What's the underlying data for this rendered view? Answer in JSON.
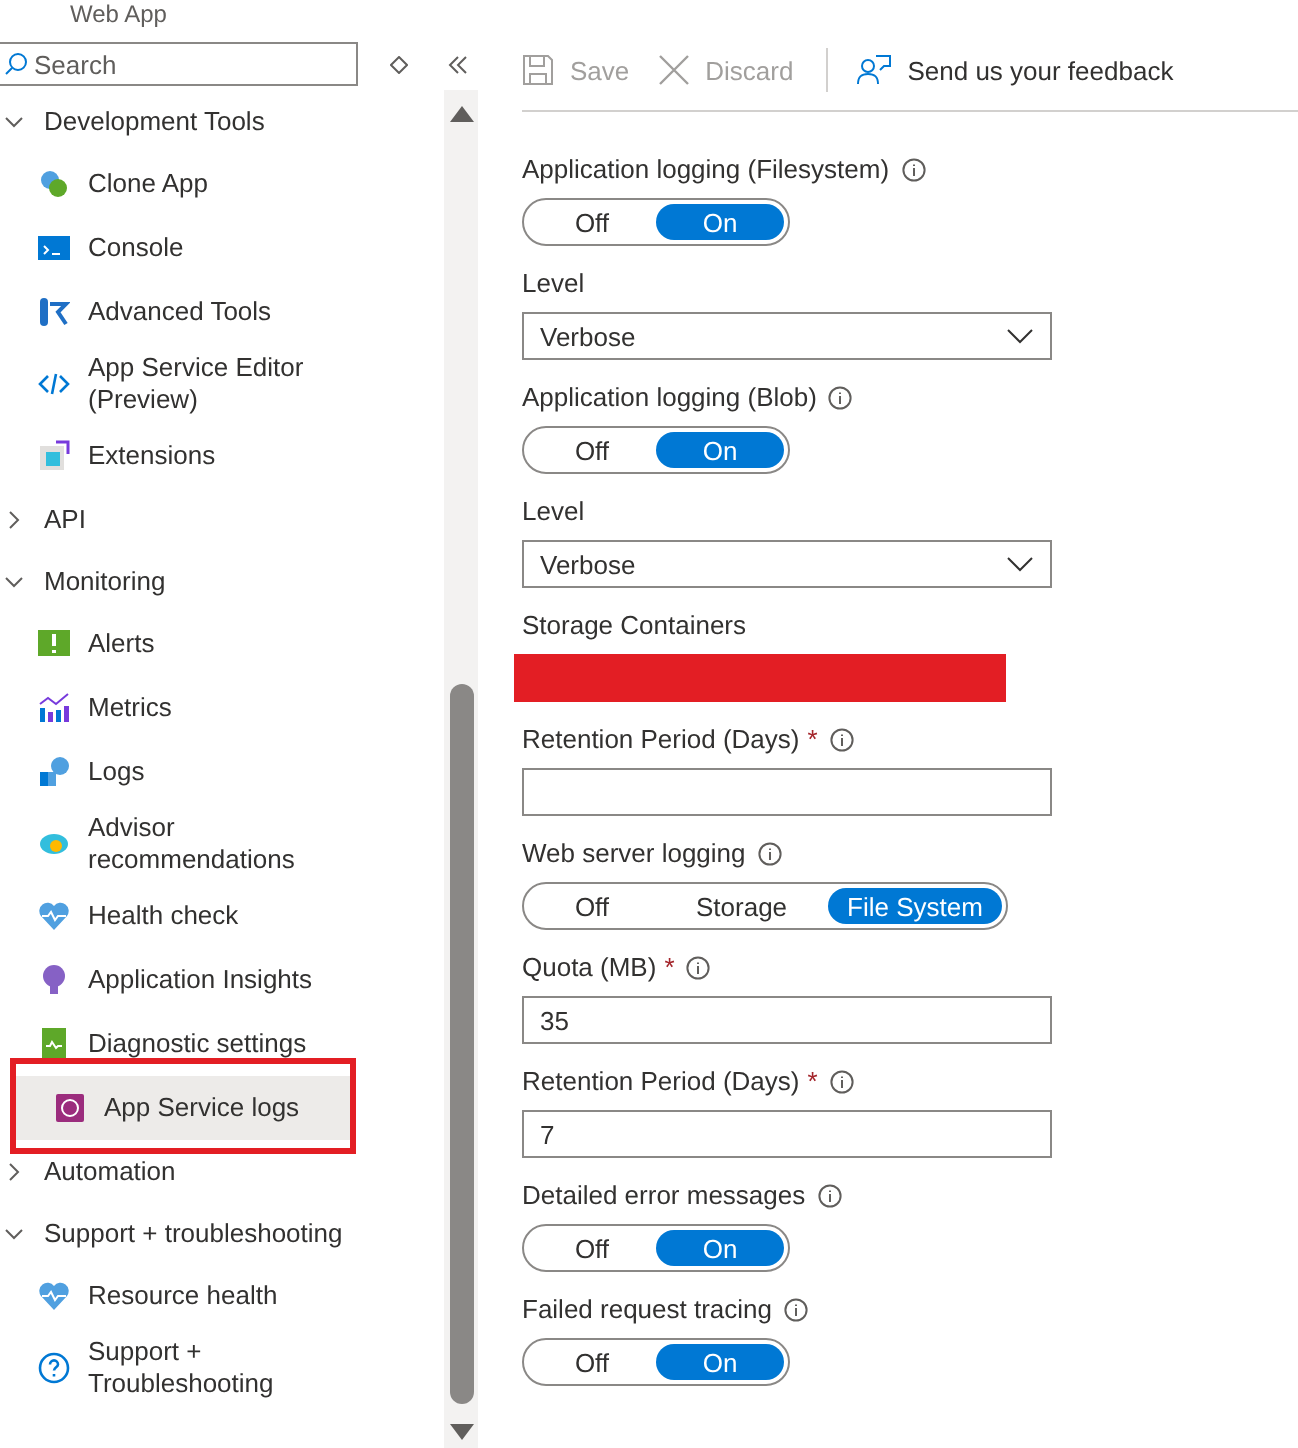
{
  "header": {
    "title": "Web App"
  },
  "search": {
    "placeholder": "Search"
  },
  "sidebar": {
    "groups": [
      {
        "label": "Development Tools",
        "expanded": true,
        "children": [
          {
            "label": "Clone App",
            "selected": false
          },
          {
            "label": "Console",
            "selected": false
          },
          {
            "label": "Advanced Tools",
            "selected": false
          },
          {
            "label": "App Service Editor (Preview)",
            "selected": false
          },
          {
            "label": "Extensions",
            "selected": false
          }
        ]
      },
      {
        "label": "API",
        "expanded": false
      },
      {
        "label": "Monitoring",
        "expanded": true,
        "children": [
          {
            "label": "Alerts",
            "selected": false
          },
          {
            "label": "Metrics",
            "selected": false
          },
          {
            "label": "Logs",
            "selected": false
          },
          {
            "label": "Advisor recommendations",
            "selected": false
          },
          {
            "label": "Health check",
            "selected": false
          },
          {
            "label": "Application Insights",
            "selected": false
          },
          {
            "label": "Diagnostic settings",
            "selected": false
          },
          {
            "label": "App Service logs",
            "selected": true
          }
        ]
      },
      {
        "label": "Automation",
        "expanded": false
      },
      {
        "label": "Support + troubleshooting",
        "expanded": true,
        "children": [
          {
            "label": "Resource health",
            "selected": false
          },
          {
            "label": "Support + Troubleshooting",
            "selected": false
          }
        ]
      }
    ]
  },
  "toolbar": [
    {
      "label": "Save",
      "disabled": true
    },
    {
      "label": "Discard",
      "disabled": true
    },
    {
      "label": "Send us your feedback",
      "disabled": false
    }
  ],
  "form": [
    {
      "kind": "toggle",
      "label": "Application logging (Filesystem)",
      "info": true,
      "options": [
        {
          "label": "Off",
          "selected": false
        },
        {
          "label": "On",
          "selected": true
        }
      ]
    },
    {
      "kind": "select",
      "label": "Level",
      "info": false,
      "value": "Verbose"
    },
    {
      "kind": "toggle",
      "label": "Application logging (Blob)",
      "info": true,
      "options": [
        {
          "label": "Off",
          "selected": false
        },
        {
          "label": "On",
          "selected": true
        }
      ]
    },
    {
      "kind": "select",
      "label": "Level",
      "info": false,
      "value": "Verbose"
    },
    {
      "kind": "redacted",
      "label": "Storage Containers",
      "info": false
    },
    {
      "kind": "text",
      "label": "Retention Period (Days)",
      "required_mark": "*",
      "info": true
    },
    {
      "kind": "toggle",
      "label": "Web server logging",
      "info": true,
      "options": [
        {
          "label": "Off",
          "selected": false
        },
        {
          "label": "Storage",
          "selected": false
        },
        {
          "label": "File System",
          "selected": true
        }
      ]
    },
    {
      "kind": "text",
      "label": "Quota (MB)",
      "required_mark": "*",
      "info": true,
      "value": "35"
    },
    {
      "kind": "text",
      "label": "Retention Period (Days)",
      "required_mark": "*",
      "info": true,
      "value": "7"
    },
    {
      "kind": "toggle",
      "label": "Detailed error messages",
      "info": true,
      "options": [
        {
          "label": "Off",
          "selected": false
        },
        {
          "label": "On",
          "selected": true
        }
      ]
    },
    {
      "kind": "toggle",
      "label": "Failed request tracing",
      "info": true,
      "options": [
        {
          "label": "Off",
          "selected": false
        },
        {
          "label": "On",
          "selected": true
        }
      ]
    }
  ]
}
